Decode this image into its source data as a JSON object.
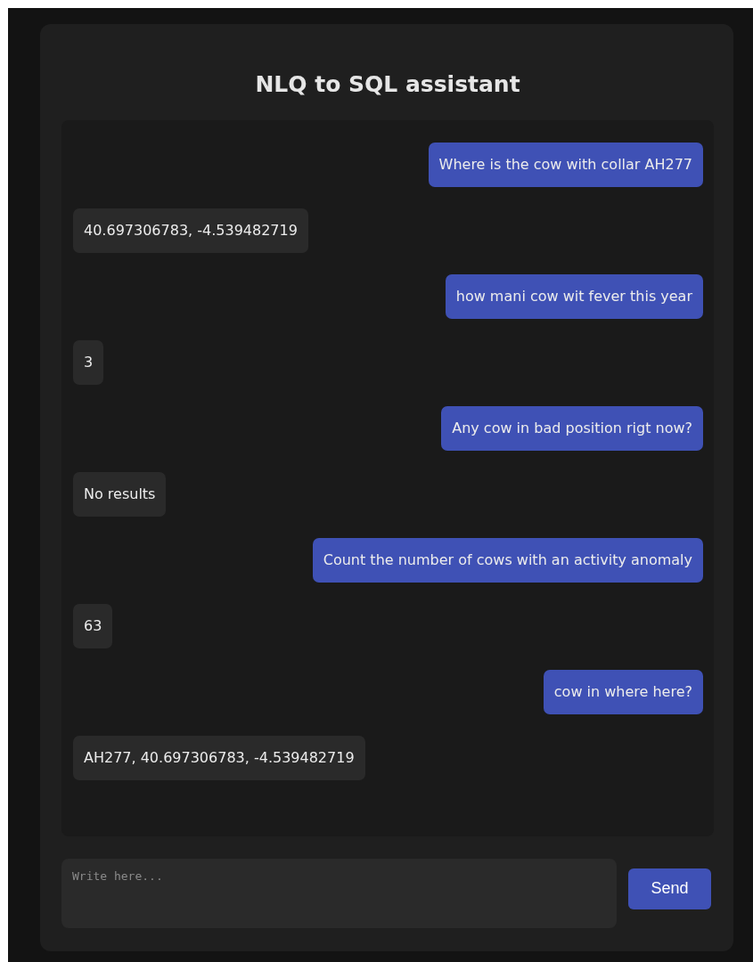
{
  "title": "NLQ to SQL assistant",
  "messages": [
    {
      "kind": "user",
      "text": "Where is the cow with collar AH277"
    },
    {
      "kind": "assistant",
      "text": "40.697306783, -4.539482719"
    },
    {
      "kind": "user",
      "text": "how mani cow wit fever this year"
    },
    {
      "kind": "assistant",
      "text": "3"
    },
    {
      "kind": "user",
      "text": "Any cow in bad position rigt now?"
    },
    {
      "kind": "assistant",
      "text": "No results"
    },
    {
      "kind": "user",
      "text": "Count the number of cows with an activity anomaly"
    },
    {
      "kind": "assistant",
      "text": "63"
    },
    {
      "kind": "user",
      "text": "cow in where here?"
    },
    {
      "kind": "assistant",
      "text": "AH277, 40.697306783, -4.539482719"
    }
  ],
  "input": {
    "placeholder": "Write here..."
  },
  "send_button": "Send"
}
